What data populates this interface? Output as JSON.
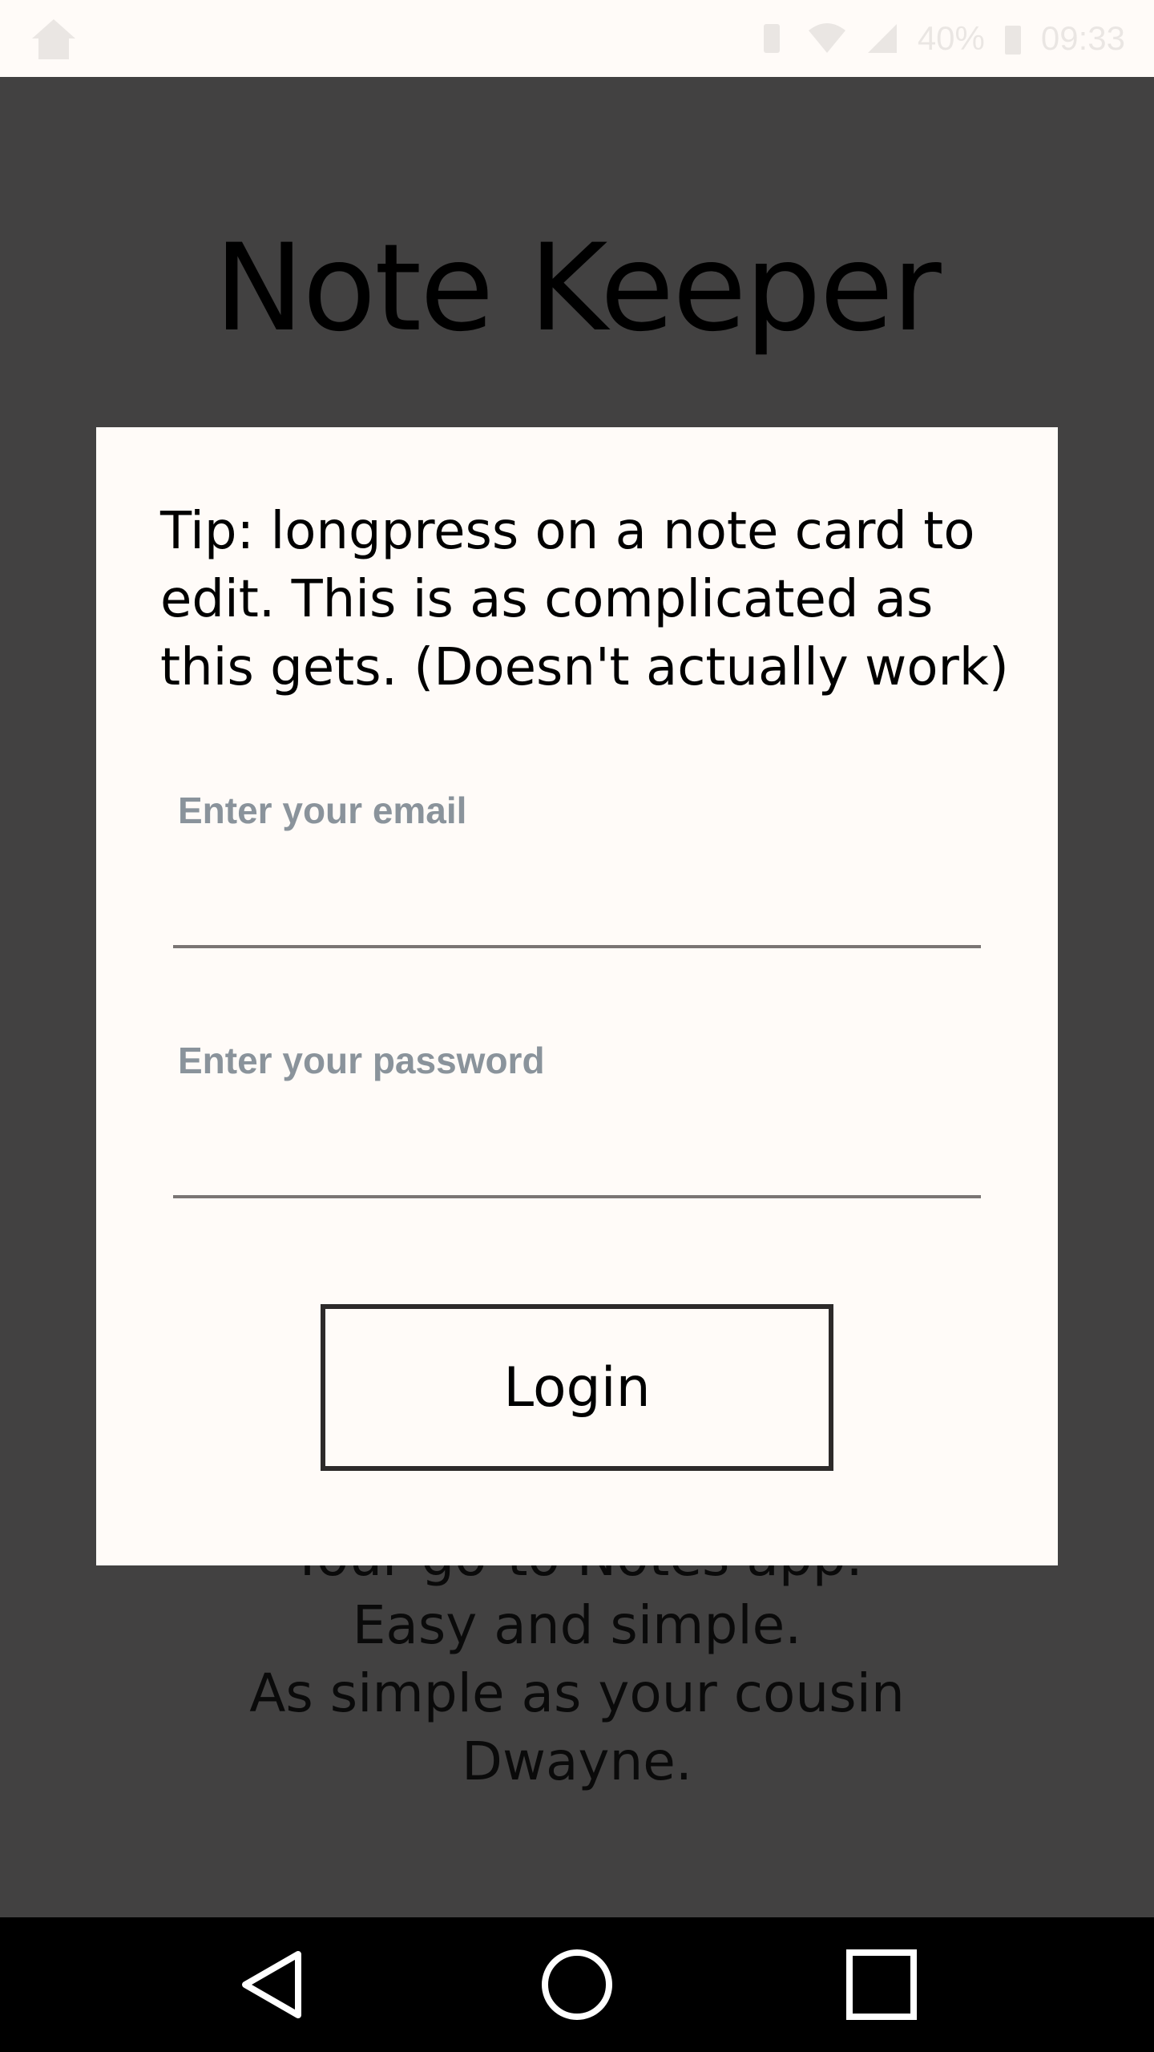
{
  "status_bar": {
    "battery": "40%",
    "time": "09:33"
  },
  "app": {
    "title": "Note Keeper",
    "tagline": [
      "Your go-to Notes app.",
      "Easy and simple.",
      "As simple as your cousin",
      "Dwayne."
    ]
  },
  "dialog": {
    "tip": "Tip: longpress on a note card to edit. This is as complicated as this gets. (Doesn't actually work)",
    "email": {
      "label": "Enter your email",
      "value": ""
    },
    "password": {
      "label": "Enter your password",
      "value": ""
    },
    "login_label": "Login"
  },
  "nav_bar": {
    "icons": [
      "back-icon",
      "home-icon",
      "recents-icon"
    ]
  },
  "colors": {
    "scrim": "#424141",
    "dialog_bg": "#fffbf8",
    "label": "#8a939b",
    "underline": "#7a7574",
    "button_border": "#2d2a2a"
  }
}
